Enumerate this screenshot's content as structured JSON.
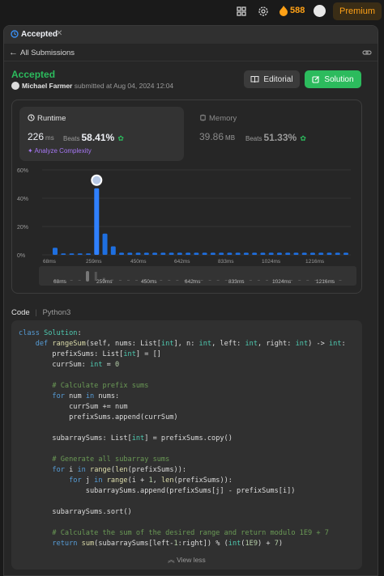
{
  "topbar": {
    "streak": "588",
    "premium_label": "Premium"
  },
  "tab": {
    "label": "Accepted",
    "close": "✕"
  },
  "subnav": {
    "label": "All Submissions"
  },
  "submission": {
    "status": "Accepted",
    "author": "Michael Farmer",
    "submitted_text": "submitted at Aug 04, 2024 12:04",
    "editorial_label": "Editorial",
    "solution_label": "Solution"
  },
  "runtime": {
    "title": "Runtime",
    "value": "226",
    "unit": "ms",
    "beats_label": "Beats",
    "beats_value": "58.41%",
    "analyze_label": "Analyze Complexity"
  },
  "memory": {
    "title": "Memory",
    "value": "39.86",
    "unit": "MB",
    "beats_label": "Beats",
    "beats_value": "51.33%"
  },
  "colors": {
    "accent_green": "#2cbb5d",
    "bar_blue": "#1e6fe0",
    "premium_orange": "#ffa116"
  },
  "chart_data": {
    "type": "bar",
    "yticks": [
      "60%",
      "40%",
      "20%",
      "0%"
    ],
    "ylim": [
      0,
      60
    ],
    "xticks": [
      "68ms",
      "259ms",
      "450ms",
      "642ms",
      "833ms",
      "1024ms",
      "1216ms"
    ],
    "values": [
      5,
      1,
      1,
      1,
      1,
      47,
      15,
      6,
      1.5,
      1.5,
      1.5,
      1.5,
      1.5,
      1.5,
      1.5,
      1.5,
      1.5,
      1.5,
      1.5,
      1.5,
      1.5,
      1.5,
      1.5,
      1.5,
      1.5,
      1.5,
      1.5,
      1.5,
      1.5,
      1.5,
      1.5,
      1.5,
      1.5,
      1.5,
      1.5,
      1.5
    ],
    "highlight_index": 5,
    "grid": true
  },
  "code": {
    "header_label": "Code",
    "language": "Python3",
    "view_less": "View less"
  }
}
